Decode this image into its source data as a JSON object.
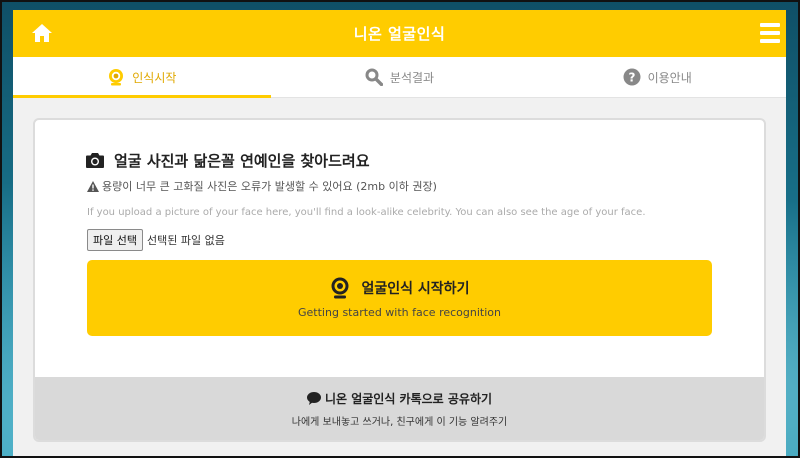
{
  "header": {
    "title": "니온 얼굴인식",
    "home_icon": "home-icon",
    "menu_icon": "hamburger-menu-icon"
  },
  "tabs": [
    {
      "label": "인식시작",
      "icon": "webcam-icon",
      "active": true
    },
    {
      "label": "분석결과",
      "icon": "search-icon",
      "active": false
    },
    {
      "label": "이용안내",
      "icon": "question-circle-icon",
      "active": false
    }
  ],
  "main": {
    "heading": "얼굴 사진과 닮은꼴 연예인을 찾아드려요",
    "warning": "용량이 너무 큰 고화질 사진은 오류가 발생할 수 있어요 (2mb 이하 권장)",
    "description": "If you upload a picture of your face here, you'll find a look-alike celebrity. You can also see the age of your face.",
    "file_button": "파일 선택",
    "file_status": "선택된 파일 없음",
    "start_button": {
      "label": "얼굴인식 시작하기",
      "sublabel": "Getting started with face recognition"
    }
  },
  "share": {
    "label": "니온 얼굴인식 카톡으로 공유하기",
    "sublabel": "나에게 보내놓고 쓰거나, 친구에게 이 기능 알려주기"
  },
  "colors": {
    "accent": "#ffcc00",
    "active_tab_text": "#e0a800",
    "inactive_tab_text": "#888888"
  }
}
